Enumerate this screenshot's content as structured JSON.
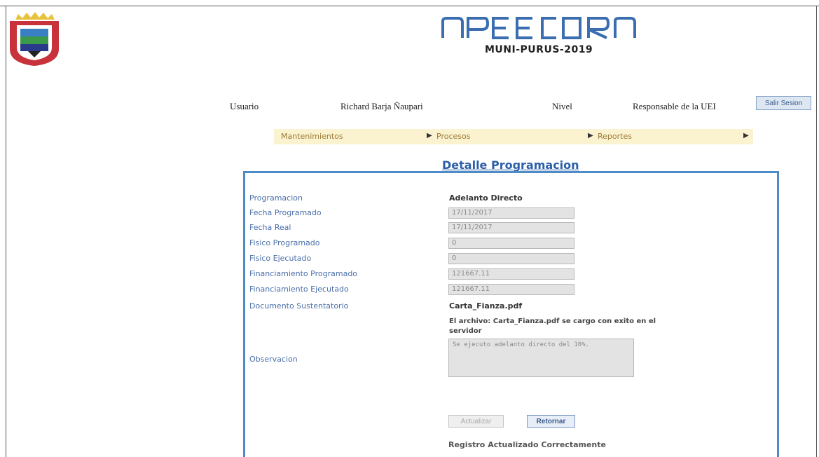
{
  "header": {
    "subtitle": "MUNI-PURUS-2019"
  },
  "user_bar": {
    "user_label": "Usuario",
    "user_name": "Richard Barja Ñaupari",
    "level_label": "Nivel",
    "level_value": "Responsable de la UEI",
    "logout_label": "Salir Sesion"
  },
  "menu": {
    "items": [
      {
        "label": "Mantenimientos"
      },
      {
        "label": "Procesos"
      },
      {
        "label": "Reportes"
      }
    ]
  },
  "page": {
    "title": "Detalle Programacion"
  },
  "form": {
    "programacion_label": "Programacion",
    "programacion_value": "Adelanto Directo",
    "fecha_programado_label": "Fecha Programado",
    "fecha_programado_value": "17/11/2017",
    "fecha_real_label": "Fecha Real",
    "fecha_real_value": "17/11/2017",
    "fisico_programado_label": "Fisico Programado",
    "fisico_programado_value": "0",
    "fisico_ejecutado_label": "Fisico Ejecutado",
    "fisico_ejecutado_value": "0",
    "fin_programado_label": "Financiamiento Programado",
    "fin_programado_value": "121667.11",
    "fin_ejecutado_label": "Financiamiento Ejecutado",
    "fin_ejecutado_value": "121667.11",
    "documento_label": "Documento Sustentatorio",
    "documento_value": "Carta_Fianza.pdf",
    "upload_message": "El archivo: Carta_Fianza.pdf se cargo con exito en el servidor",
    "observacion_label": "Observacion",
    "observacion_value": "Se ejecuto adelanto directo del 10%.",
    "update_button": "Actualizar",
    "return_button": "Retornar",
    "status_message": "Registro Actualizado Correctamente"
  },
  "colors": {
    "accent_blue": "#2a5ea8",
    "panel_border": "#4f8bc7",
    "menu_bg": "#fbf3cf"
  }
}
